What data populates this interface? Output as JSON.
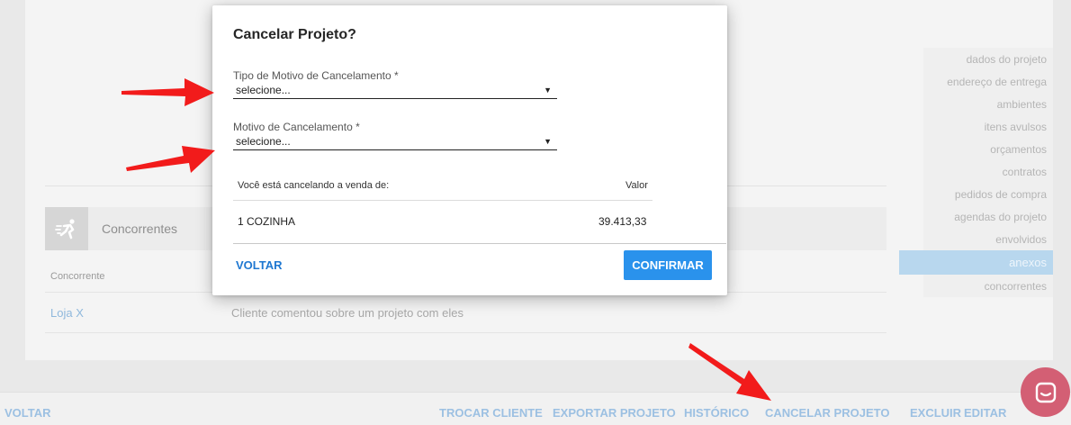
{
  "colors": {
    "accent": "#2a92ec",
    "link": "#1f78d1",
    "annotation_arrow": "#f21b1b",
    "chat": "#d35f74",
    "active_menu": "#b8d7ee"
  },
  "background": {
    "section": {
      "icon": "runner-icon",
      "title": "Concorrentes"
    },
    "table": {
      "column_header": "Concorrente",
      "rows": [
        {
          "name": "Loja X",
          "comment": "Cliente comentou sobre um projeto com eles"
        }
      ]
    }
  },
  "side_menu": {
    "items": [
      {
        "label": "dados do projeto"
      },
      {
        "label": "endereço de entrega"
      },
      {
        "label": "ambientes"
      },
      {
        "label": "itens avulsos"
      },
      {
        "label": "orçamentos"
      },
      {
        "label": "contratos"
      },
      {
        "label": "pedidos de compra"
      },
      {
        "label": "agendas do projeto"
      },
      {
        "label": "envolvidos"
      },
      {
        "label": "anexos",
        "active": true
      },
      {
        "label": "concorrentes"
      }
    ]
  },
  "footer": {
    "back": "VOLTAR",
    "change_client": "TROCAR CLIENTE",
    "export_project": "EXPORTAR PROJETO",
    "history": "HISTÓRICO",
    "cancel_project": "CANCELAR PROJETO",
    "delete": "EXCLUIR",
    "edit": "EDITAR"
  },
  "dialog": {
    "title": "Cancelar Projeto?",
    "reason_type": {
      "label": "Tipo de Motivo de Cancelamento *",
      "value": "selecione..."
    },
    "reason": {
      "label": "Motivo de Cancelamento *",
      "value": "selecione..."
    },
    "table": {
      "header_left": "Você está cancelando a venda de:",
      "header_right": "Valor",
      "rows": [
        {
          "item": "1 COZINHA",
          "value": "39.413,33"
        }
      ]
    },
    "back_label": "VOLTAR",
    "confirm_label": "CONFIRMAR"
  }
}
